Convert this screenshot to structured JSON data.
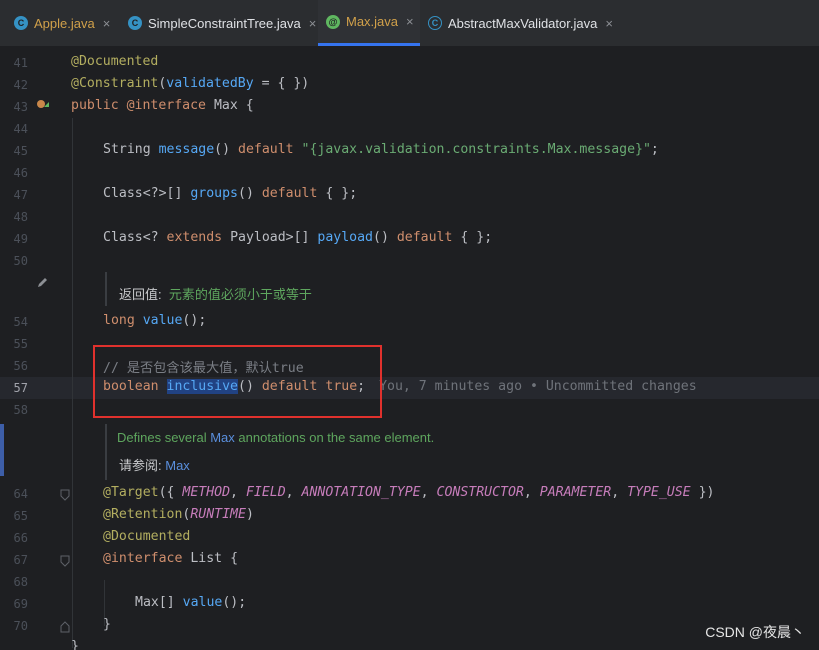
{
  "tabs": [
    {
      "label": "Apple.java",
      "icon": "class-file-icon",
      "active": false
    },
    {
      "label": "SimpleConstraintTree.java",
      "icon": "class-file-icon",
      "active": false
    },
    {
      "label": "Max.java",
      "icon": "annotation-file-icon",
      "active": true
    },
    {
      "label": "AbstractMaxValidator.java",
      "icon": "abstract-class-file-icon",
      "active": false
    }
  ],
  "tab_close_glyph": "×",
  "lines": {
    "l41": "41",
    "l42": "42",
    "l43": "43",
    "l44": "44",
    "l45": "45",
    "l46": "46",
    "l47": "47",
    "l48": "48",
    "l49": "49",
    "l50": "50",
    "l54": "54",
    "l55": "55",
    "l56": "56",
    "l57": "57",
    "l58": "58",
    "l64": "64",
    "l65": "65",
    "l66": "66",
    "l67": "67",
    "l68": "68",
    "l69": "69",
    "l70": "70"
  },
  "code": {
    "documented": "@Documented",
    "constraint_at": "@Constraint",
    "constraint_open": "(",
    "validated_by": "validatedBy",
    "constraint_rest": " = { })",
    "kw_public": "public",
    "at_interface": "@interface",
    "max_name": "Max",
    "brace_open": " {",
    "string_type": "String",
    "message": "message",
    "parens": "()",
    "kw_default": "default",
    "message_str": "\"{javax.validation.constraints.Max.message}\"",
    "semicolon": ";",
    "class_generic": "Class<?>[]",
    "groups": "groups",
    "empty_braces": "{ }",
    "class_q": "Class<?",
    "kw_extends": "extends",
    "payload_type": "Payload>[]",
    "payload": "payload",
    "kw_long": "long",
    "value": "value",
    "comment_56": "// 是否包含该最大值，默认true",
    "kw_boolean": "boolean",
    "inclusive": "inclusive",
    "kw_true": "true",
    "blame": "You, 7 minutes ago • Uncommitted changes",
    "target_at": "@Target",
    "target_open": "({ ",
    "c_method": "METHOD",
    "c_field": "FIELD",
    "c_annotation_type": "ANNOTATION_TYPE",
    "c_constructor": "CONSTRUCTOR",
    "c_parameter": "PARAMETER",
    "c_type_use": "TYPE_USE",
    "comma": ", ",
    "target_close": " })",
    "retention_at": "@Retention",
    "c_runtime": "RUNTIME",
    "close_paren": ")",
    "list_name": "List",
    "max_arr": "Max[]",
    "brace_close": "}"
  },
  "docs": {
    "return_label": "返回值:",
    "return_text": "元素的值必须小于或等于",
    "defines_prefix": "Defines several ",
    "defines_link": "Max",
    "defines_suffix": " annotations on the same element.",
    "see_label": "请参阅:",
    "see_link": "Max"
  },
  "watermark": "CSDN @夜晨丶",
  "colors": {
    "highlight_box": "#e0312d",
    "keyword": "#cf8e6d",
    "annotation": "#b3ae60",
    "function": "#56a8f5",
    "string": "#6aab73"
  }
}
